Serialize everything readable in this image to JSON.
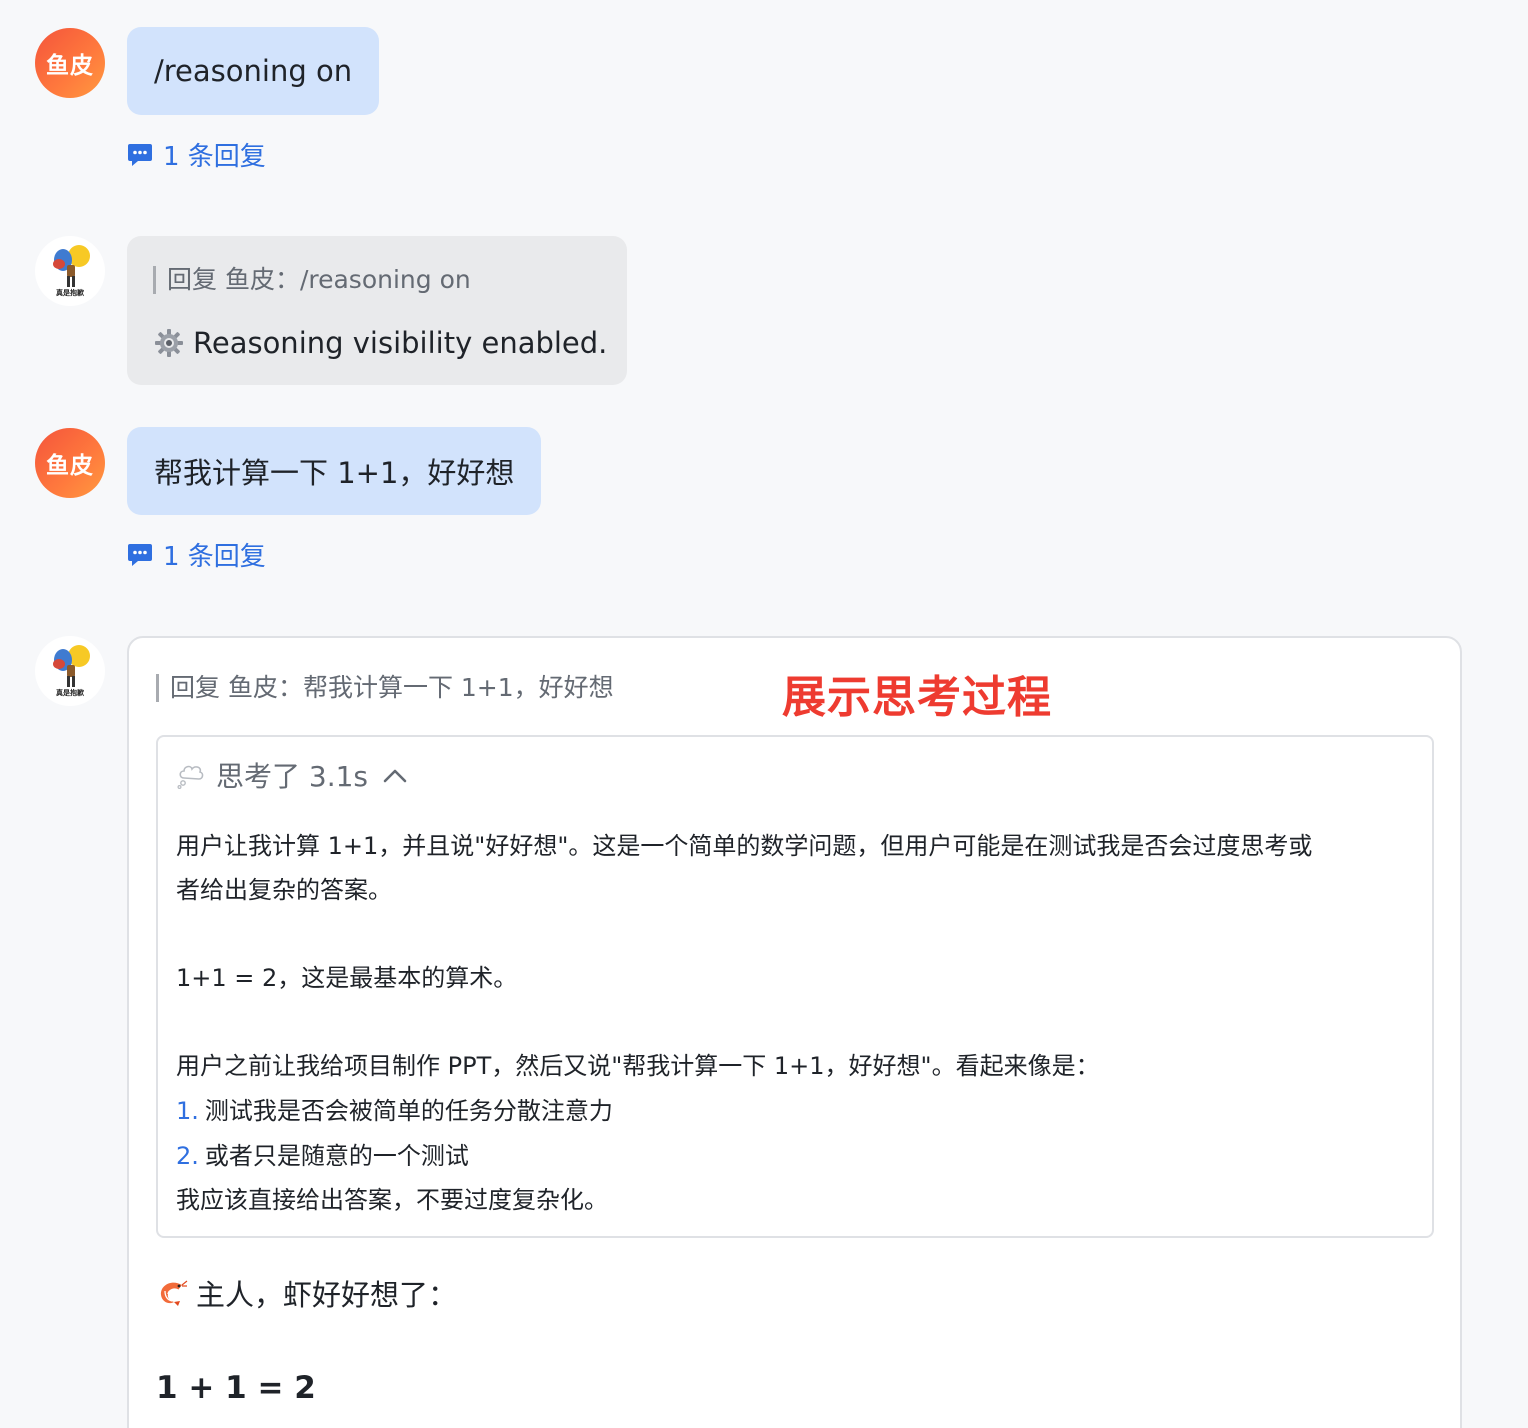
{
  "colors": {
    "user_bubble": "#d2e3fc",
    "bot_bubble": "#e9eaec",
    "link_blue": "#2f6fe0",
    "annotation_red": "#ee3b30"
  },
  "messages": {
    "msg1": {
      "avatar_text": "鱼皮",
      "text": "/reasoning on",
      "reply_link": "1 条回复"
    },
    "msg2": {
      "avatar_caption": "真是抱歉",
      "quote": "回复 鱼皮：/reasoning on",
      "icon": "gear-icon",
      "text": "Reasoning visibility enabled."
    },
    "msg3": {
      "avatar_text": "鱼皮",
      "text": "帮我计算一下 1+1，好好想",
      "reply_link": "1 条回复"
    },
    "msg4": {
      "avatar_caption": "真是抱歉",
      "quote": "回复 鱼皮：帮我计算一下 1+1，好好想",
      "annotation": "展示思考过程",
      "thinking": {
        "icon": "thought-bubble-icon",
        "title": "思考了 3.1s",
        "para1_line1": "用户让我计算 1+1，并且说\"好好想\"。这是一个简单的数学问题，但用户可能是在测试我是否会过度思考或",
        "para1_line2": "者给出复杂的答案。",
        "para2": "1+1 = 2，这是最基本的算术。",
        "para3": "用户之前让我给项目制作 PPT，然后又说\"帮我计算一下 1+1，好好想\"。看起来像是：",
        "list": [
          {
            "num": "1.",
            "text": "测试我是否会被简单的任务分散注意力"
          },
          {
            "num": "2.",
            "text": "或者只是随意的一个测试"
          }
        ],
        "conclusion": "我应该直接给出答案，不要过度复杂化。"
      },
      "answer_icon": "shrimp-icon",
      "answer_intro": "主人，虾好好想了：",
      "answer": "1 + 1 = 2"
    }
  }
}
